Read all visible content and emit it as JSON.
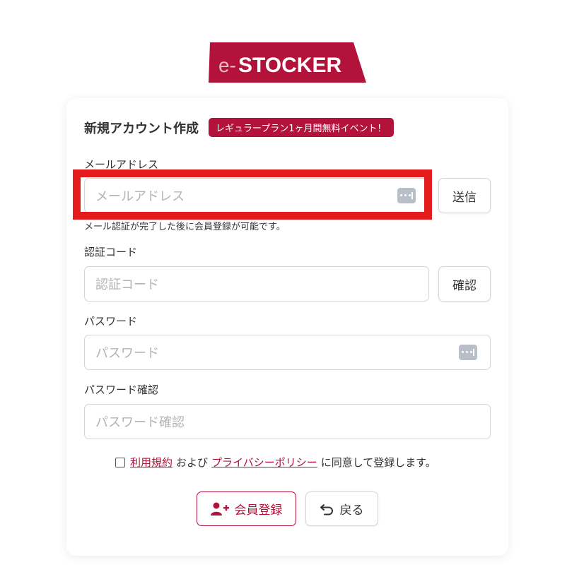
{
  "logo": {
    "prefix": "e-",
    "name": "STOCKER",
    "brand_color": "#b3123b"
  },
  "form": {
    "title": "新規アカウント作成",
    "badge": "レギュラープラン1ヶ月間無料イベント！",
    "email": {
      "label": "メールアドレス",
      "placeholder": "メールアドレス",
      "send_label": "送信",
      "hint": "メール認証が完了した後に会員登録が可能です。"
    },
    "code": {
      "label": "認証コード",
      "placeholder": "認証コード",
      "confirm_label": "確認"
    },
    "password": {
      "label": "パスワード",
      "placeholder": "パスワード"
    },
    "password_confirm": {
      "label": "パスワード確認",
      "placeholder": "パスワード確認"
    },
    "agreement": {
      "terms_link": "利用規約",
      "and_text": "および",
      "privacy_link": "プライバシーポリシー",
      "suffix": "に同意して登録します。",
      "checked": false
    },
    "register_label": "会員登録",
    "back_label": "戻る"
  },
  "colors": {
    "accent": "#b3123b",
    "highlight": "#e41b1b"
  }
}
